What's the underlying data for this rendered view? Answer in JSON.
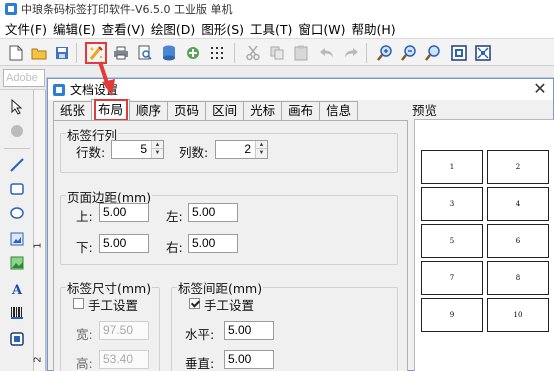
{
  "app": {
    "title": "中琅条码标签打印软件-V6.5.0 工业版 单机",
    "menu": [
      "文件(F)",
      "编辑(E)",
      "查看(V)",
      "绘图(D)",
      "图形(S)",
      "工具(T)",
      "窗口(W)",
      "帮助(H)"
    ],
    "font_name": "Adobe",
    "ruler_marks": [
      "1",
      "2"
    ]
  },
  "toolbar_icons": [
    "new-icon",
    "open-icon",
    "save-icon",
    "document-settings-icon",
    "print-icon",
    "print-preview-icon",
    "database-icon",
    "data-source-icon",
    "grid-icon",
    "cut-icon",
    "copy-icon",
    "paste-icon",
    "undo-icon",
    "redo-icon",
    "zoom-in-icon",
    "zoom-out-icon",
    "zoom-fit-icon",
    "zoom-width-icon",
    "zoom-page-icon"
  ],
  "left_tools": [
    "pointer-icon",
    "hand-icon",
    "line-icon",
    "rectangle-icon",
    "ellipse-icon",
    "image-icon",
    "picture-icon",
    "text-icon",
    "barcode-icon",
    "qrcode-icon"
  ],
  "dialog": {
    "title": "文档设置",
    "tabs": [
      "纸张",
      "布局",
      "顺序",
      "页码",
      "区间",
      "光标",
      "画布",
      "信息"
    ],
    "active_tab": "布局",
    "rows_cols": {
      "title": "标签行列",
      "rows_label": "行数:",
      "rows_value": "5",
      "cols_label": "列数:",
      "cols_value": "2"
    },
    "margins": {
      "title": "页面边距(mm)",
      "top_label": "上:",
      "top_value": "5.00",
      "left_label": "左:",
      "left_value": "5.00",
      "bottom_label": "下:",
      "bottom_value": "5.00",
      "right_label": "右:",
      "right_value": "5.00"
    },
    "label_size": {
      "title": "标签尺寸(mm)",
      "manual_label": "手工设置",
      "manual_checked": false,
      "width_label": "宽:",
      "width_value": "97.50",
      "height_label": "高:",
      "height_value": "53.40"
    },
    "label_spacing": {
      "title": "标签间距(mm)",
      "manual_label": "手工设置",
      "manual_checked": true,
      "horizontal_label": "水平:",
      "horizontal_value": "5.00",
      "vertical_label": "垂直:",
      "vertical_value": "5.00"
    },
    "preview": {
      "title": "预览",
      "cells": [
        "1",
        "2",
        "3",
        "4",
        "5",
        "6",
        "7",
        "8",
        "9",
        "10"
      ]
    }
  },
  "annotation_color": "#e23a3a"
}
